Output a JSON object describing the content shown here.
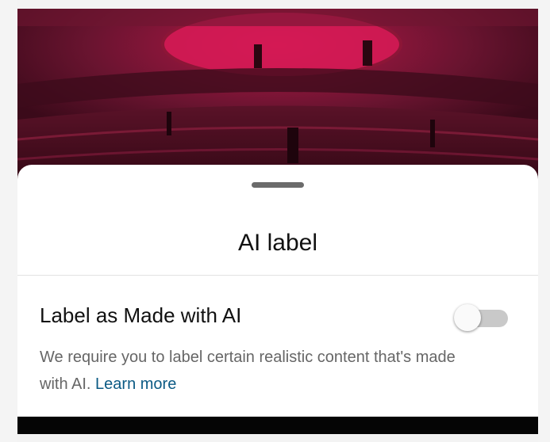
{
  "sheet": {
    "title": "AI label",
    "setting_label": "Label as Made with AI",
    "toggle_on": false,
    "description": "We require you to label certain realistic content that's made with AI.",
    "learn_more": "Learn more"
  },
  "colors": {
    "media_tint": "#4e0f22",
    "link": "#0b5a84",
    "sheet_bg": "#ffffff"
  }
}
